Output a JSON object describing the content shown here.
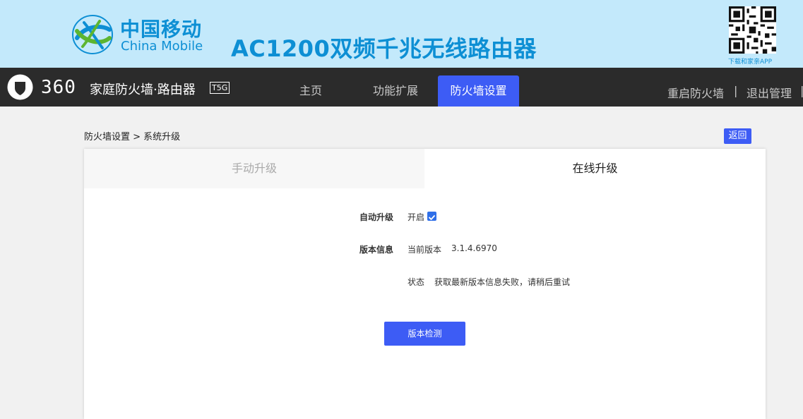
{
  "banner": {
    "brand_cn": "中国移动",
    "brand_en": "China Mobile",
    "product_title": "AC1200双频千兆无线路由器",
    "qr_caption": "下载和家亲APP"
  },
  "navbar": {
    "brand_360": "360",
    "brand_text": "家庭防火墙·路由器",
    "brand_model": "T5G",
    "items": [
      {
        "label": "主页"
      },
      {
        "label": "功能扩展"
      },
      {
        "label": "防火墙设置"
      }
    ],
    "reboot_label": "重启防火墙",
    "separator": "|",
    "logout_label": "退出管理"
  },
  "breadcrumb": "防火墙设置 > 系统升级",
  "back_label": "返回",
  "tabs": {
    "manual": "手动升级",
    "online": "在线升级"
  },
  "form": {
    "auto_upgrade_label": "自动升级",
    "auto_upgrade_value": "开启",
    "auto_upgrade_checked": true,
    "version_label": "版本信息",
    "current_version_label": "当前版本",
    "current_version_value": "3.1.4.6970",
    "status_label": "状态",
    "status_value": "获取最新版本信息失败，请稍后重试",
    "check_button": "版本检测"
  },
  "colors": {
    "accent": "#3d5cf5",
    "banner_bg": "#c3e9fb",
    "brand_blue": "#0d8fd4",
    "navbar_bg": "#2b2b2b"
  }
}
